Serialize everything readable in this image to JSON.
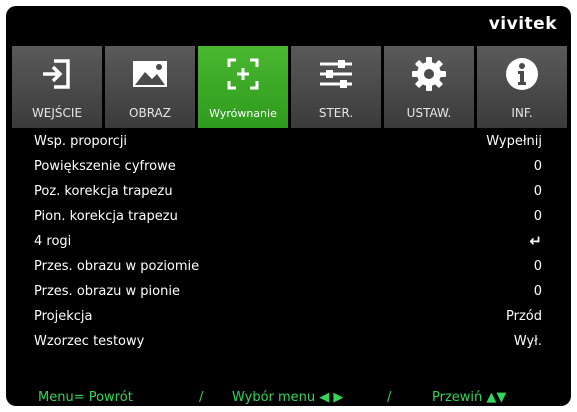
{
  "brand": "vivitek",
  "tabs": [
    {
      "label": "WEJŚCIE",
      "icon": "input-icon",
      "active": false
    },
    {
      "label": "OBRAZ",
      "icon": "picture-icon",
      "active": false
    },
    {
      "label": "Wyrównanie",
      "icon": "alignment-icon",
      "active": true
    },
    {
      "label": "STER.",
      "icon": "sliders-icon",
      "active": false
    },
    {
      "label": "USTAW.",
      "icon": "gear-icon",
      "active": false
    },
    {
      "label": "INF.",
      "icon": "info-icon",
      "active": false
    }
  ],
  "menu": [
    {
      "name": "Wsp. proporcji",
      "value": "Wypełnij"
    },
    {
      "name": "Powiększenie cyfrowe",
      "value": "0"
    },
    {
      "name": "Poz. korekcja trapezu",
      "value": "0"
    },
    {
      "name": "Pion. korekcja trapezu",
      "value": "0"
    },
    {
      "name": "4 rogi",
      "value": "↵"
    },
    {
      "name": "Przes. obrazu w poziomie",
      "value": "0"
    },
    {
      "name": "Przes. obrazu w pionie",
      "value": "0"
    },
    {
      "name": "Projekcja",
      "value": "Przód"
    },
    {
      "name": "Wzorzec testowy",
      "value": "Wył."
    }
  ],
  "footer": {
    "menu_back": "Menu= Powrót",
    "sep1": "/",
    "select": "Wybór menu ◀ ▶",
    "sep2": "/",
    "scroll": "Przewiń ▲▼"
  },
  "colors": {
    "active_tab": "#3aa826",
    "footer_text": "#35d35a",
    "background": "#000000"
  }
}
